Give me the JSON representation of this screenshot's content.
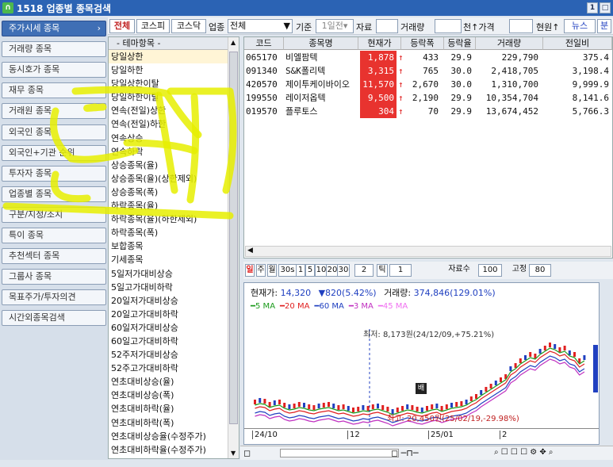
{
  "window": {
    "title": "1518 업종별 종목검색",
    "icon": "app-icon"
  },
  "nav": {
    "items": [
      "주가시세 종목",
      "거래량 종목",
      "동시호가 종목",
      "재무 종목",
      "거래원 종목",
      "외국인 종목",
      "외국인+기관 순위",
      "투자자 종목",
      "업종별 종목",
      "구분/지정/조치",
      "특이 종목",
      "추천섹터 종목",
      "그룹사 종목",
      "목표주가/투자의견",
      "시간외종목검색"
    ]
  },
  "toolbar": {
    "tab_all": "전체",
    "tab_kospi": "코스피",
    "tab_kosdaq": "코스닥",
    "sector_label": "업종",
    "sector_value": "전체",
    "base_label": "기준",
    "base_value": "1일전",
    "data_label": "자료",
    "volume_label": "거래량",
    "unit_label": "천↑가격",
    "price_unit": "현원↑",
    "news": "뉴스",
    "split": "분"
  },
  "theme": {
    "header": "- 테마항목 -",
    "items": [
      "당일상한",
      "당일하한",
      "당일상한이탈",
      "당일하한이탈",
      "연속(전일)상한",
      "연속(전일)하한",
      "연속상승",
      "연속하락",
      "상승종목(율)",
      "상승종목(율)(상한제외)",
      "상승종목(폭)",
      "하락종목(율)",
      "하락종목(율)(하한제외)",
      "하락종목(폭)",
      "보합종목",
      "기세종목",
      "5일저가대비상승",
      "5일고가대비하락",
      "20일저가대비상승",
      "20일고가대비하락",
      "60일저가대비상승",
      "60일고가대비하락",
      "52주저가대비상승",
      "52주고가대비하락",
      "연초대비상승(율)",
      "연초대비상승(폭)",
      "연초대비하락(율)",
      "연초대비하락(폭)",
      "연초대비상승율(수정주가)",
      "연초대비하락율(수정주가)"
    ]
  },
  "grid": {
    "headers": [
      "코드",
      "종목명",
      "현재가",
      "등락폭",
      "등락율",
      "거래량",
      "전일비"
    ],
    "rows": [
      [
        "065170",
        "비엘팜텍",
        "1,878",
        "↑",
        "433",
        "29.9",
        "229,790",
        "375.4"
      ],
      [
        "091340",
        "S&K폴리텍",
        "3,315",
        "↑",
        "765",
        "30.0",
        "2,418,705",
        "3,198.4"
      ],
      [
        "420570",
        "제이투케이바이오",
        "11,570",
        "↑",
        "2,670",
        "30.0",
        "1,310,700",
        "9,999.9"
      ],
      [
        "199550",
        "레이저옵텍",
        "9,500",
        "↑",
        "2,190",
        "29.9",
        "10,354,704",
        "8,141.6"
      ],
      [
        "019570",
        "플루토스",
        "304",
        "↑",
        "70",
        "29.9",
        "13,674,452",
        "5,766.3"
      ]
    ]
  },
  "controls": {
    "buttons": [
      "일",
      "주",
      "월",
      "30s",
      "1",
      "5",
      "10",
      "20",
      "30"
    ],
    "input1": "2",
    "tick": "틱",
    "tick_value": "1",
    "datacount_label": "자료수",
    "datacount": "100",
    "fixed_label": "고정",
    "fixed": "80"
  },
  "chart_info": {
    "price_label": "현재가:",
    "price": "14,320",
    "change": "▼820(5.42%)",
    "vol_label": "거래량:",
    "vol": "374,846(129.01%)",
    "ma": [
      "5 MA",
      "20 MA",
      "60 MA",
      "3 MA",
      "45 MA"
    ],
    "ma_colors": [
      "#1a9a1a",
      "#e02020",
      "#2040c0",
      "#c030c0",
      "#f070f0"
    ],
    "max_label": "최저: 8,173원(24/12/09,+75.21%)",
    "min_label": "최고: 20,450원(25/02/19,-29.98%)",
    "marker": "배",
    "x_ticks": [
      "24/10",
      "12",
      "25/01",
      "2"
    ]
  },
  "annotation": {
    "text": "5개",
    "color": "#e8e800"
  }
}
